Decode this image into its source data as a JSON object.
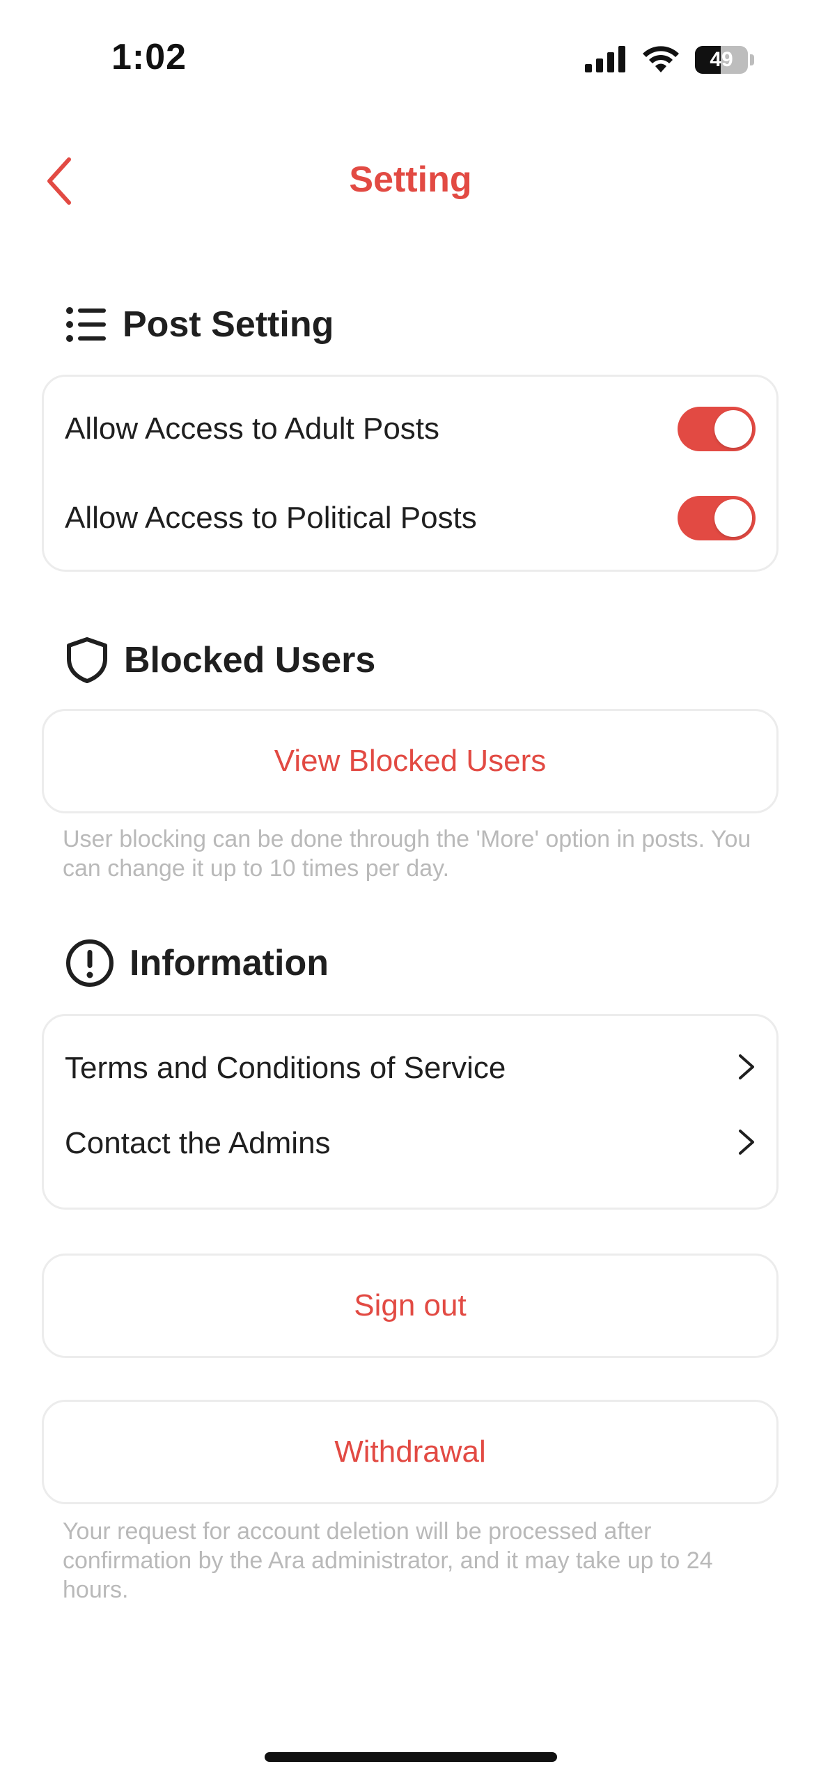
{
  "status_bar": {
    "time": "1:02",
    "battery_percent": "49",
    "icons": [
      "cellular-signal-icon",
      "wifi-icon",
      "battery-icon"
    ]
  },
  "header": {
    "title": "Setting",
    "back_icon": "chevron-left-icon"
  },
  "post_setting": {
    "title": "Post Setting",
    "icon": "list-icon",
    "items": [
      {
        "label": "Allow Access to Adult Posts",
        "enabled": true
      },
      {
        "label": "Allow Access to Political Posts",
        "enabled": true
      }
    ]
  },
  "blocked_users": {
    "title": "Blocked Users",
    "icon": "shield-icon",
    "button_label": "View Blocked Users",
    "note": "User blocking can be done through the 'More' option in posts. You can change it up to 10 times per day."
  },
  "information": {
    "title": "Information",
    "icon": "info-circle-icon",
    "items": [
      {
        "label": "Terms and Conditions of Service"
      },
      {
        "label": "Contact the Admins"
      }
    ]
  },
  "account": {
    "sign_out_label": "Sign out",
    "withdrawal_label": "Withdrawal",
    "withdrawal_note": "Your request for account deletion will be processed after confirmation by the Ara administrator, and it may take up to 24 hours."
  },
  "colors": {
    "accent": "#e24a43",
    "text": "#1f1f1f",
    "muted": "#b9b9b9",
    "card_border": "#ececec"
  }
}
